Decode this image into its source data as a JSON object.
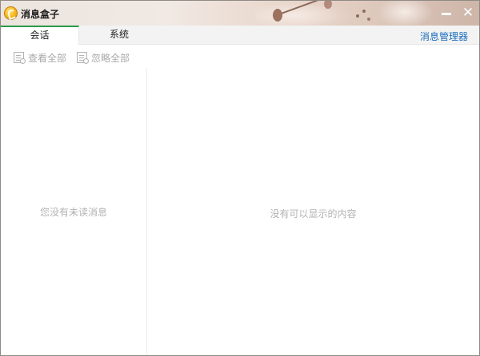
{
  "window": {
    "title": "消息盒子",
    "minimize_icon": "minimize-icon",
    "close_icon": "close-icon",
    "close_glyph": "✕"
  },
  "tabs": [
    {
      "label": "会话",
      "active": true
    },
    {
      "label": "系统",
      "active": false
    }
  ],
  "header": {
    "message_manager_label": "消息管理器"
  },
  "toolbar": {
    "view_all_label": "查看全部",
    "ignore_all_label": "忽略全部"
  },
  "left_pane": {
    "empty_text": "您没有未读消息"
  },
  "right_pane": {
    "empty_text": "没有可以显示的内容"
  },
  "colors": {
    "tab_accent": "#2a9a4a",
    "link": "#1b6ebd",
    "muted_text": "#b2b2b2"
  }
}
